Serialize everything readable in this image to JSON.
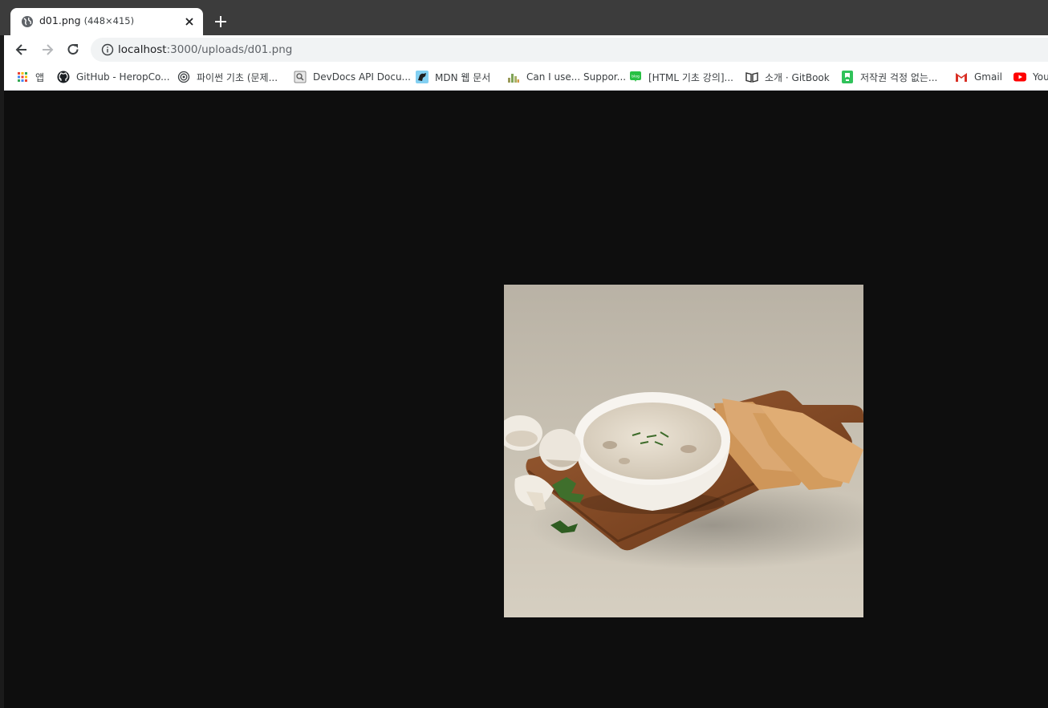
{
  "browser": {
    "tab": {
      "title": "d01.png",
      "dims": "(448×415)"
    },
    "address": {
      "host": "localhost",
      "rest": ":3000/uploads/d01.png"
    },
    "bookmarks": [
      {
        "label": "앱",
        "icon": "apps-grid-icon"
      },
      {
        "label": "GitHub - HeropCo...",
        "icon": "github-icon"
      },
      {
        "label": "파이썬 기초 (문제...",
        "icon": "target-icon"
      },
      {
        "label": "DevDocs API Docu...",
        "icon": "devdocs-icon"
      },
      {
        "label": "MDN 웹 문서",
        "icon": "mdn-icon"
      },
      {
        "label": "Can I use... Suppor...",
        "icon": "caniuse-icon"
      },
      {
        "label": "[HTML 기초 강의]...",
        "icon": "blog-icon"
      },
      {
        "label": "소개 · GitBook",
        "icon": "gitbook-icon"
      },
      {
        "label": "저작권 걱정 없는...",
        "icon": "bookmark-green-icon"
      },
      {
        "label": "Gmail",
        "icon": "gmail-icon"
      },
      {
        "label": "You",
        "icon": "youtube-icon"
      }
    ]
  },
  "image": {
    "subject": "mushroom-soup-photo",
    "colors": {
      "background": "#0e0e0e",
      "backdrop": "#cbc3b5",
      "board": "#8a4f2a",
      "bowl": "#f4f1ec",
      "soup": "#ddd3c4",
      "cracker": "#d6a066",
      "parsley": "#3d6b2a"
    }
  }
}
